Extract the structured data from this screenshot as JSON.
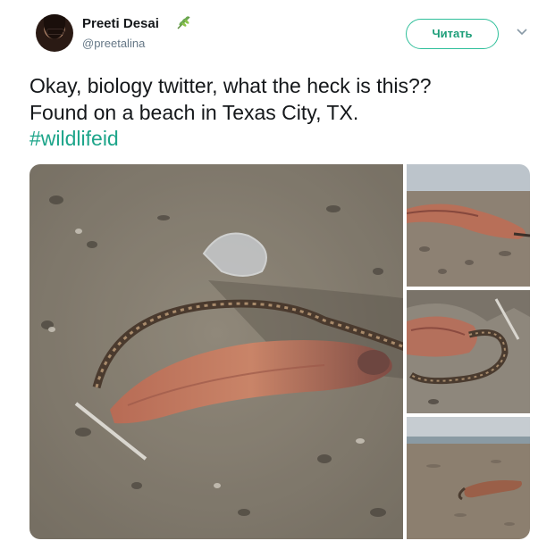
{
  "author": {
    "name": "Preeti Desai",
    "handle": "@preetalina",
    "badge_icon": "leaf-icon"
  },
  "follow_button": {
    "label": "Читать"
  },
  "menu_icon": "chevron-down-icon",
  "tweet": {
    "line1": "Okay, biology twitter, what the heck is this??",
    "line2": "Found on a beach in Texas City, TX.",
    "hashtag": "#wildlifeid"
  },
  "colors": {
    "accent": "#1da58a",
    "text": "#14171a",
    "secondary": "#657786"
  },
  "media": {
    "photos": [
      {
        "id": "main",
        "subject": "eel-like creature on sand, close-up"
      },
      {
        "id": "thumb-1",
        "subject": "creature on beach, low angle"
      },
      {
        "id": "thumb-2",
        "subject": "creature close-up with tail"
      },
      {
        "id": "thumb-3",
        "subject": "beach with creature and sea"
      }
    ]
  }
}
